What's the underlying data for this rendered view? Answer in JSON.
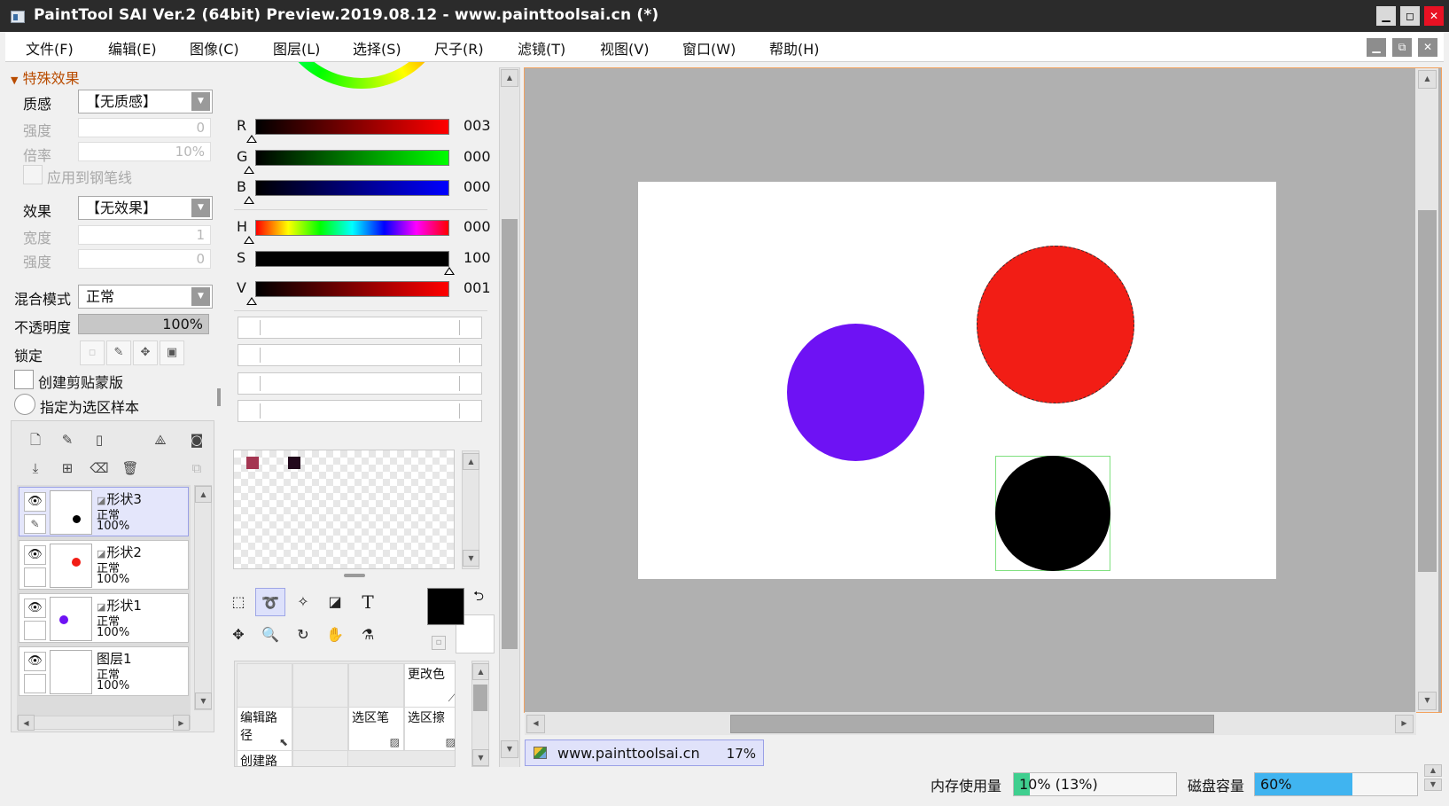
{
  "window": {
    "title": "PaintTool SAI Ver.2 (64bit) Preview.2019.08.12 - www.painttoolsai.cn (*)",
    "min_glyph": "▁",
    "max_glyph": "◻",
    "close_glyph": "✕"
  },
  "mdi": {
    "min_glyph": "▁",
    "restore_glyph": "⧉",
    "close_glyph": "✕"
  },
  "menu": [
    "文件(F)",
    "编辑(E)",
    "图像(C)",
    "图层(L)",
    "选择(S)",
    "尺子(R)",
    "滤镜(T)",
    "视图(V)",
    "窗口(W)",
    "帮助(H)"
  ],
  "effects": {
    "header": "特殊效果",
    "texture_label": "质感",
    "texture_value": "【无质感】",
    "texture_strength_label": "强度",
    "texture_strength_value": "0",
    "texture_scale_label": "倍率",
    "texture_scale_value": "10%",
    "apply_pen_label": "应用到钢笔线",
    "effect_label": "效果",
    "effect_value": "【无效果】",
    "width_label": "宽度",
    "width_value": "1",
    "effect_strength_label": "强度",
    "effect_strength_value": "0"
  },
  "layer_props": {
    "blend_label": "混合模式",
    "blend_value": "正常",
    "opacity_label": "不透明度",
    "opacity_value": "100%",
    "lock_label": "锁定",
    "clip_label": "创建剪贴蒙版",
    "sample_label": "指定为选区样本"
  },
  "layers": [
    {
      "name": "形状3",
      "mode": "正常",
      "opacity": "100%",
      "dot_color": "#000000",
      "selected": true
    },
    {
      "name": "形状2",
      "mode": "正常",
      "opacity": "100%",
      "dot_color": "#f21d15",
      "selected": false
    },
    {
      "name": "形状1",
      "mode": "正常",
      "opacity": "100%",
      "dot_color": "#6e12f4",
      "selected": false
    },
    {
      "name": "图层1",
      "mode": "正常",
      "opacity": "100%",
      "dot_color": null,
      "selected": false
    }
  ],
  "color": {
    "r_label": "R",
    "r_value": "003",
    "g_label": "G",
    "g_value": "000",
    "b_label": "B",
    "b_value": "000",
    "h_label": "H",
    "h_value": "000",
    "s_label": "S",
    "s_value": "100",
    "v_label": "V",
    "v_value": "001",
    "main_color": "#000000",
    "swatches": [
      "#a43652",
      "#22091c"
    ]
  },
  "tools": {
    "text_tool_glyph": "T"
  },
  "brushes": [
    {
      "label": "",
      "icon": ""
    },
    {
      "label": "",
      "icon": ""
    },
    {
      "label": "",
      "icon": ""
    },
    {
      "label": "更改色",
      "icon": "⟋"
    },
    {
      "label": "编辑路径",
      "icon": "⬉"
    },
    {
      "label": "",
      "icon": ""
    },
    {
      "label": "选区笔",
      "icon": "▨"
    },
    {
      "label": "选区擦",
      "icon": "▨"
    },
    {
      "label": "创建路径",
      "icon": ""
    }
  ],
  "canvas": {
    "tab_name": "www.painttoolsai.cn",
    "zoom": "17%",
    "shapes": [
      {
        "color": "#6e12f4"
      },
      {
        "color": "#f21d15"
      },
      {
        "color": "#000000"
      }
    ]
  },
  "status": {
    "memory_label": "内存使用量",
    "memory_text": "10% (13%)",
    "memory_fraction": 0.1,
    "disk_label": "磁盘容量",
    "disk_text": "60%",
    "disk_fraction": 0.6
  }
}
